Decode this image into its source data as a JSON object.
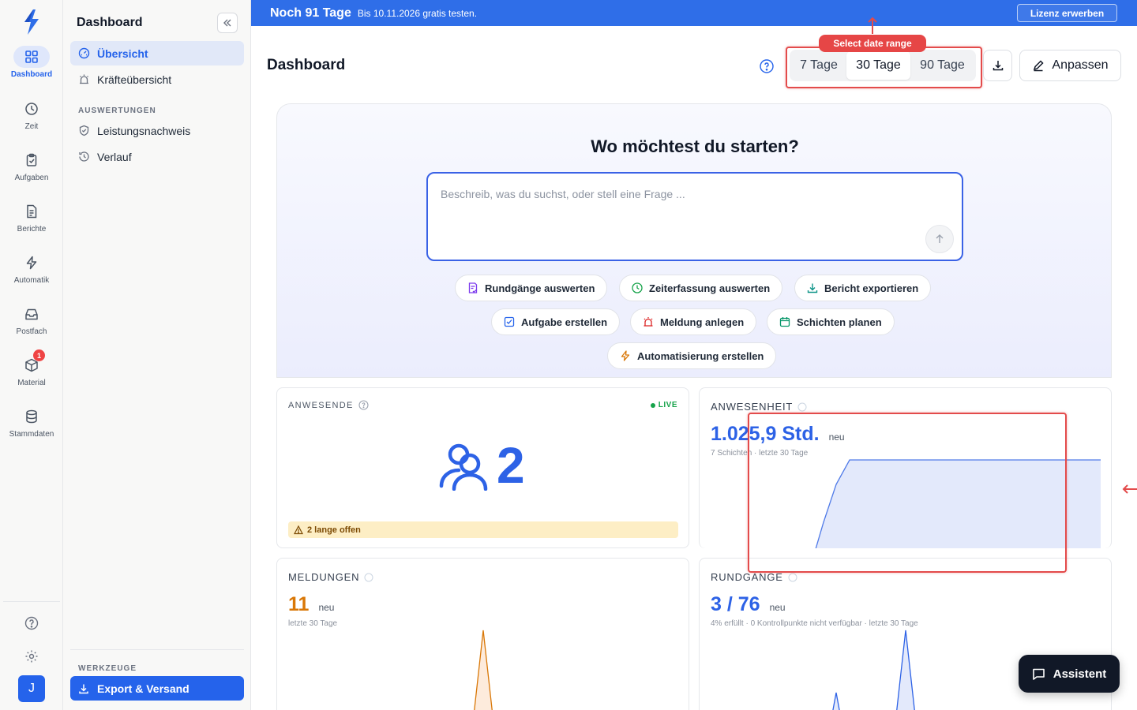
{
  "rail": {
    "items": [
      {
        "label": "Dashboard",
        "icon": "grid-icon",
        "active": true
      },
      {
        "label": "Zeit",
        "icon": "clock-icon"
      },
      {
        "label": "Aufgaben",
        "icon": "clipboard-check-icon"
      },
      {
        "label": "Berichte",
        "icon": "document-icon"
      },
      {
        "label": "Automatik",
        "icon": "lightning-icon"
      },
      {
        "label": "Postfach",
        "icon": "inbox-icon"
      },
      {
        "label": "Material",
        "icon": "box-icon",
        "badge": "1"
      },
      {
        "label": "Stammdaten",
        "icon": "database-icon"
      }
    ],
    "avatar": "J"
  },
  "sidebar": {
    "title": "Dashboard",
    "items": [
      {
        "label": "Übersicht",
        "icon": "gauge-icon",
        "active": true
      },
      {
        "label": "Kräfteübersicht",
        "icon": "siren-icon"
      }
    ],
    "section_label": "AUSWERTUNGEN",
    "section_items": [
      {
        "label": "Leistungsnachweis",
        "icon": "shield-check-icon"
      },
      {
        "label": "Verlauf",
        "icon": "history-icon"
      }
    ],
    "tools_label": "WERKZEUGE",
    "export_label": "Export & Versand"
  },
  "banner": {
    "main": "Noch 91 Tage",
    "sub": "Bis 10.11.2026 gratis testen.",
    "button": "Lizenz erwerben"
  },
  "header": {
    "title": "Dashboard",
    "ranges": [
      "7 Tage",
      "30 Tage",
      "90 Tage"
    ],
    "selected_range": "30 Tage",
    "highlight_tag": "Select date range",
    "edit_label": "Anpassen"
  },
  "hero": {
    "title": "Wo möchtest du starten?",
    "placeholder": "Beschreib, was du suchst, oder stell eine Frage ...",
    "chips": [
      {
        "label": "Rundgänge auswerten",
        "icon": "checklist-icon",
        "color": "#7c3aed"
      },
      {
        "label": "Zeiterfassung auswerten",
        "icon": "clock-icon",
        "color": "#16a34a"
      },
      {
        "label": "Bericht exportieren",
        "icon": "download-icon",
        "color": "#0d9488"
      },
      {
        "label": "Aufgabe erstellen",
        "icon": "checkbox-icon",
        "color": "#2563eb"
      },
      {
        "label": "Meldung anlegen",
        "icon": "siren-icon",
        "color": "#dc2626"
      },
      {
        "label": "Schichten planen",
        "icon": "calendar-icon",
        "color": "#059669"
      },
      {
        "label": "Automatisierung erstellen",
        "icon": "lightning-icon",
        "color": "#d97706"
      }
    ]
  },
  "cards": {
    "anwesende": {
      "label": "ANWESENDE",
      "live": "LIVE",
      "value": "2",
      "warning": "2 lange offen"
    },
    "anwesenheit": {
      "label": "ANWESENHEIT",
      "value": "1.025,9 Std.",
      "tag": "neu",
      "sub": "7 Schichten · letzte 30 Tage",
      "color": "#2d62e6"
    },
    "meldungen": {
      "label": "MELDUNGEN",
      "value": "11",
      "tag": "neu",
      "sub": "letzte 30 Tage",
      "color": "#d97706"
    },
    "rundgaenge": {
      "label": "RUNDGÄNGE",
      "value": "3 / 76",
      "tag": "neu",
      "sub": "4% erfüllt · 0 Kontrollpunkte nicht verfügbar · letzte 30 Tage",
      "color": "#2d62e6"
    }
  },
  "assistant_label": "Assistent",
  "colors": {
    "accent": "#2563eb",
    "banner": "#2f6ee8",
    "highlight": "#e34b4b"
  }
}
